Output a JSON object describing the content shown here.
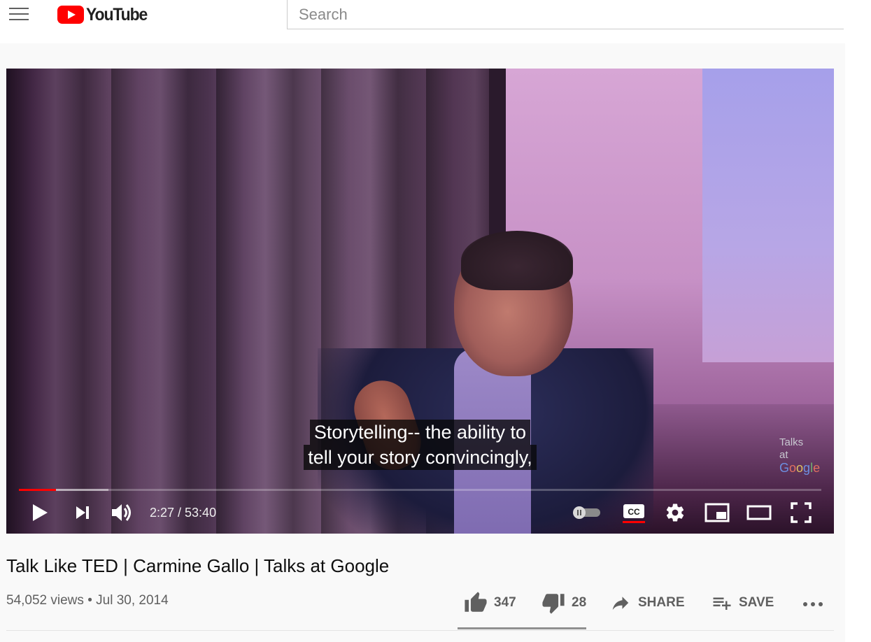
{
  "masthead": {
    "menu_icon": "hamburger-icon",
    "logo_text": "YouTube",
    "search_placeholder": "Search"
  },
  "player": {
    "captions": [
      "Storytelling-- the ability to",
      "tell your story convincingly,"
    ],
    "watermark": {
      "line1": "Talks",
      "line2": "at",
      "brand": "Google"
    },
    "progress": {
      "played_fraction": 0.046,
      "loaded_fraction": 0.112
    },
    "time_display": "2:27 / 53:40",
    "controls": {
      "play": "play-icon",
      "next": "next-icon",
      "volume": "volume-icon",
      "autoplay": "autoplay-toggle",
      "cc": "CC",
      "settings": "gear-icon",
      "miniplayer": "miniplayer-icon",
      "theater": "theater-icon",
      "fullscreen": "fullscreen-icon"
    },
    "colors": {
      "progress_played": "#ff0000",
      "cc_underline": "#ff0000"
    }
  },
  "video": {
    "title": "Talk Like TED | Carmine Gallo | Talks at Google",
    "views": "54,052 views",
    "separator": "•",
    "date": "Jul 30, 2014"
  },
  "actions": {
    "likes": "347",
    "dislikes": "28",
    "share": "SHARE",
    "save": "SAVE",
    "more_icon": "more-horiz-icon",
    "like_fraction": 0.925
  },
  "colors": {
    "brand_red": "#ff0000",
    "text_primary": "#0f0f0f",
    "text_secondary": "#606060"
  }
}
